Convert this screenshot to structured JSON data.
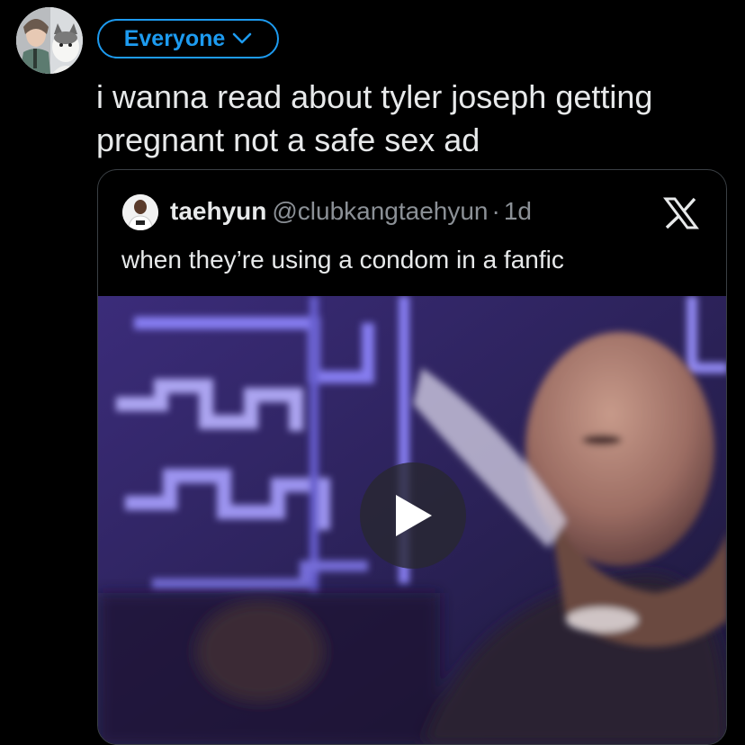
{
  "tweet": {
    "audience_label": "Everyone",
    "text": "i wanna read about tyler joseph getting\npregnant not a safe sex ad",
    "avatar_icon": "profile-photo-icon"
  },
  "quote": {
    "name": "taehyun",
    "handle": "@clubkangtaehyun",
    "separator": "·",
    "time": "1d",
    "text": "when they’re using a condom in a fanfic",
    "avatar_icon": "profile-photo-icon",
    "brand_icon": "x-logo-icon",
    "media": {
      "type": "video",
      "play_icon": "play-icon"
    }
  },
  "colors": {
    "background": "#000000",
    "text": "#e7e9ea",
    "secondary_text": "#8b9096",
    "accent": "#1d9bf0",
    "border": "#3a3f44"
  }
}
